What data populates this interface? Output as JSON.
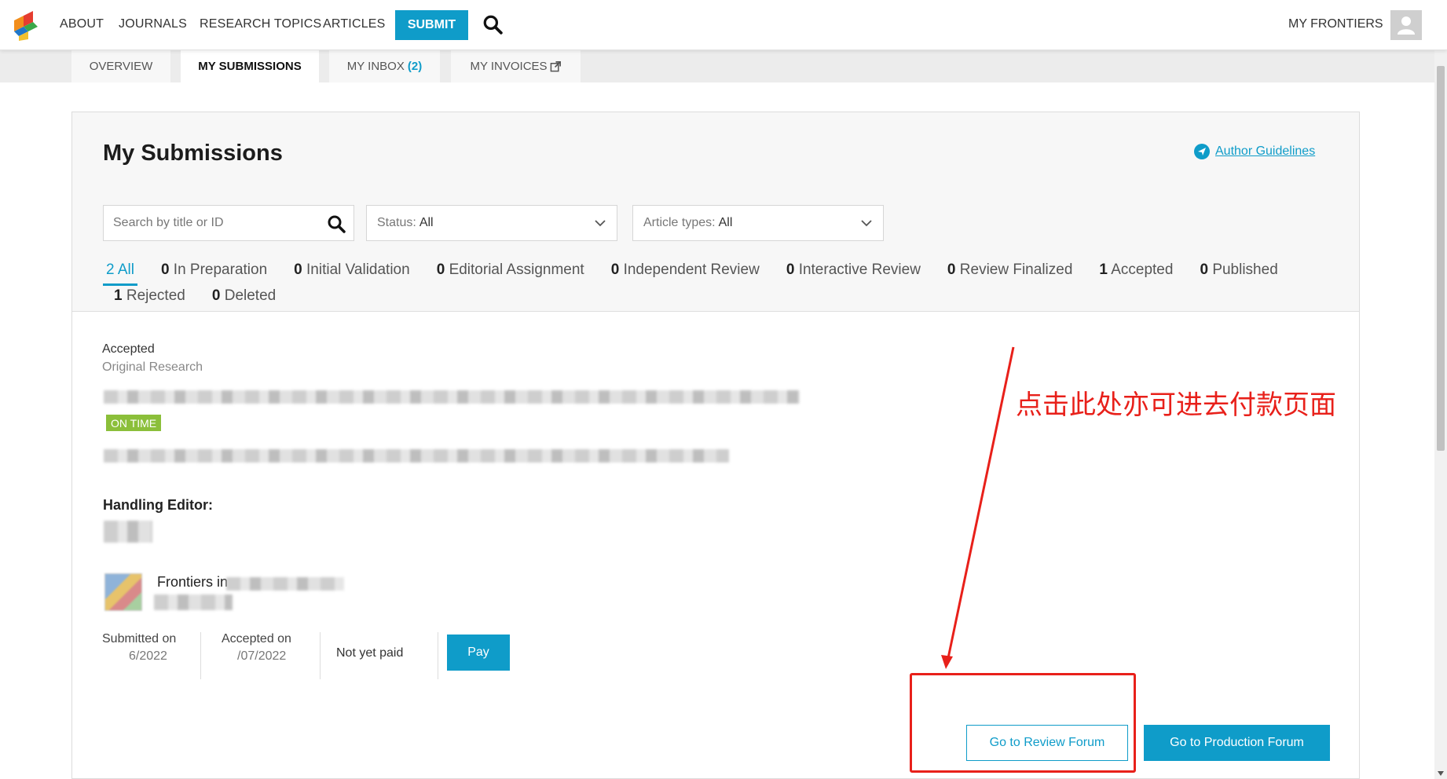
{
  "nav": {
    "links": [
      "ABOUT",
      "JOURNALS",
      "RESEARCH TOPICS",
      "ARTICLES"
    ],
    "submit_label": "SUBMIT",
    "my_frontiers": "MY FRONTIERS"
  },
  "tabs": [
    {
      "label": "OVERVIEW",
      "count": ""
    },
    {
      "label": "MY SUBMISSIONS",
      "count": ""
    },
    {
      "label": "MY INBOX",
      "count": "(2)"
    },
    {
      "label": "MY INVOICES",
      "count": ""
    }
  ],
  "page": {
    "title": "My Submissions",
    "guidelines_label": "Author Guidelines"
  },
  "filters_bar": {
    "search_placeholder": "Search by title or ID",
    "status_label": "Status:",
    "status_value": "All",
    "article_types_label": "Article types:",
    "article_types_value": "All"
  },
  "status_filters_row1": [
    {
      "count": "2",
      "label": "All"
    },
    {
      "count": "0",
      "label": "In Preparation"
    },
    {
      "count": "0",
      "label": "Initial Validation"
    },
    {
      "count": "0",
      "label": "Editorial Assignment"
    },
    {
      "count": "0",
      "label": "Independent Review"
    },
    {
      "count": "0",
      "label": "Interactive Review"
    },
    {
      "count": "0",
      "label": "Review Finalized"
    },
    {
      "count": "1",
      "label": "Accepted"
    },
    {
      "count": "0",
      "label": "Published"
    }
  ],
  "status_filters_row2": [
    {
      "count": "1",
      "label": "Rejected"
    },
    {
      "count": "0",
      "label": "Deleted"
    }
  ],
  "submission": {
    "status": "Accepted",
    "article_type": "Original Research",
    "badge": "ON TIME",
    "handling_editor_label": "Handling Editor:",
    "journal_name": "Frontiers in",
    "submitted_label": "Submitted on",
    "submitted_value": "6/2022",
    "accepted_label": "Accepted on",
    "accepted_value": "/07/2022",
    "payment_status": "Not yet paid",
    "pay_label": "Pay",
    "review_forum_label": "Go to Review Forum",
    "production_forum_label": "Go to Production Forum"
  },
  "annotation": {
    "text": "点击此处亦可进去付款页面",
    "color": "#e8201a"
  },
  "colors": {
    "accent": "#0f9cc9",
    "ontime": "#8bbf3a"
  }
}
